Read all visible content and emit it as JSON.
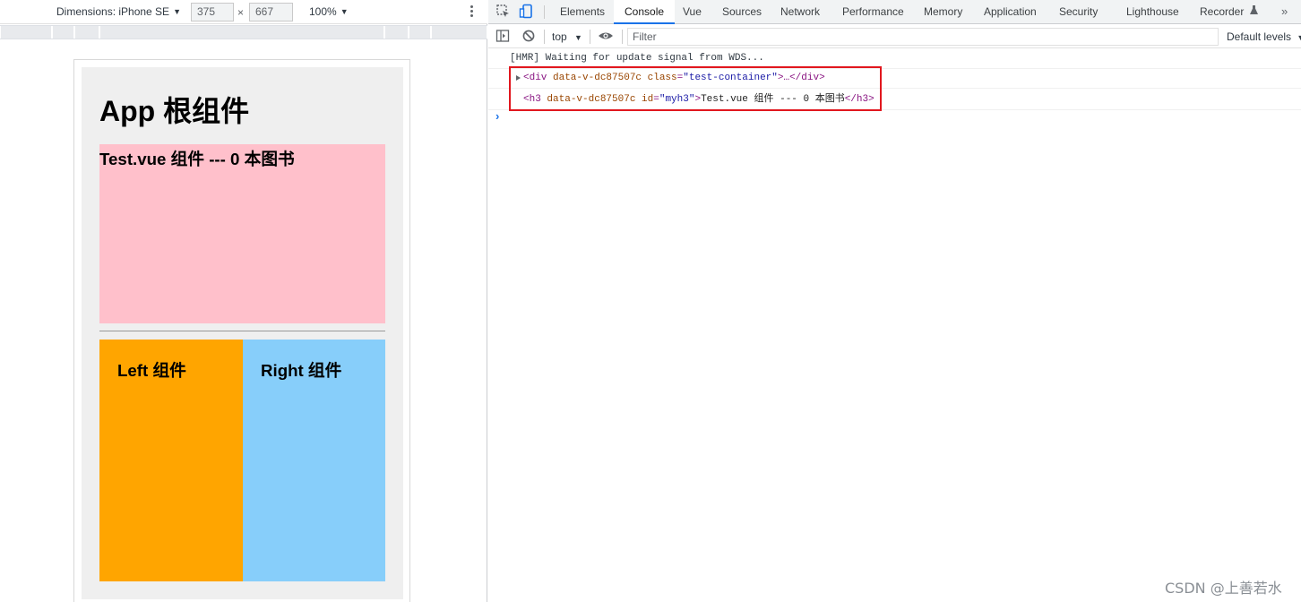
{
  "device_toolbar": {
    "dimensions_label": "Dimensions: iPhone SE",
    "width_value": "375",
    "height_value": "667",
    "times": "×",
    "zoom": "100%"
  },
  "page": {
    "app_title": "App 根组件",
    "test_title": "Test.vue 组件 --- 0 本图书",
    "left_title": "Left 组件",
    "right_title": "Right 组件",
    "colors": {
      "app_bg": "#efefef",
      "test_bg": "#ffc0cb",
      "left_bg": "#ffa500",
      "right_bg": "#87cefa"
    }
  },
  "devtools": {
    "tabs": [
      {
        "label": "Elements"
      },
      {
        "label": "Console"
      },
      {
        "label": "Vue"
      },
      {
        "label": "Sources"
      },
      {
        "label": "Network"
      },
      {
        "label": "Performance"
      },
      {
        "label": "Memory"
      },
      {
        "label": "Application"
      },
      {
        "label": "Security"
      },
      {
        "label": "Lighthouse"
      },
      {
        "label": "Recorder"
      }
    ],
    "active_tab": "Console",
    "more_tabs": "»",
    "context": "top",
    "filter_placeholder": "Filter",
    "levels": "Default levels",
    "accent_color": "#1a73e8"
  },
  "console": {
    "hmr_message": "[HMR] Waiting for update signal from WDS...",
    "div_line": {
      "open_tag": "<div",
      "attr": " data-v-dc87507c",
      "class_name": " class",
      "eq": "=",
      "class_value": "\"test-container\"",
      "close": ">…</div>"
    },
    "h3_line": {
      "open_tag": "<h3",
      "attr": " data-v-dc87507c",
      "id_name": " id",
      "eq": "=",
      "id_value": "\"myh3\"",
      "gt": ">",
      "text": "Test.vue 组件 --- 0 本图书",
      "close": "</h3>"
    },
    "prompt": "›",
    "highlight_color": "#e1171e"
  },
  "watermark": "CSDN @上善若水"
}
